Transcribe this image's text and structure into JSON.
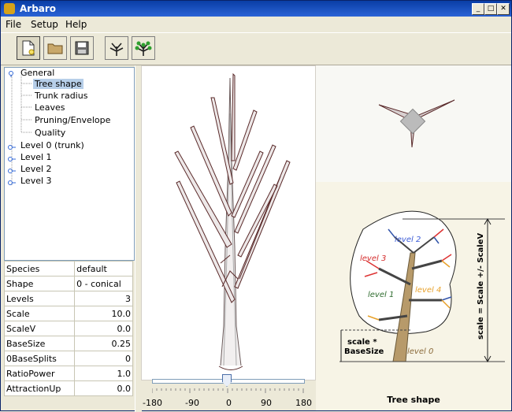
{
  "window": {
    "title": "Arbaro"
  },
  "menu": {
    "items": [
      "File",
      "Setup",
      "Help"
    ]
  },
  "tree": {
    "items": [
      {
        "label": "General"
      },
      {
        "label": "Tree shape"
      },
      {
        "label": "Trunk radius"
      },
      {
        "label": "Leaves"
      },
      {
        "label": "Pruning/Envelope"
      },
      {
        "label": "Quality"
      },
      {
        "label": "Level 0 (trunk)"
      },
      {
        "label": "Level 1"
      },
      {
        "label": "Level 2"
      },
      {
        "label": "Level 3"
      }
    ],
    "selected": "Tree shape"
  },
  "params": {
    "rows": [
      {
        "name": "Species",
        "value": "default"
      },
      {
        "name": "Shape",
        "value": "0 - conical"
      },
      {
        "name": "Levels",
        "value": "3"
      },
      {
        "name": "Scale",
        "value": "10.0"
      },
      {
        "name": "ScaleV",
        "value": "0.0"
      },
      {
        "name": "BaseSize",
        "value": "0.25"
      },
      {
        "name": "0BaseSplits",
        "value": "0"
      },
      {
        "name": "RatioPower",
        "value": "1.0"
      },
      {
        "name": "AttractionUp",
        "value": "0.0"
      }
    ]
  },
  "slider": {
    "ticks": [
      "-180",
      "-90",
      "0",
      "90",
      "180"
    ],
    "value": 0,
    "min": -180,
    "max": 180
  },
  "diagram": {
    "caption": "Tree shape",
    "labels": {
      "level2": "level 2",
      "level3": "level 3",
      "level1": "level 1",
      "level4": "level 4",
      "level0": "level 0",
      "scale_axis": "scale = Scale +/- ScaleV",
      "basesize_line1": "scale *",
      "basesize_line2": "BaseSize"
    }
  },
  "colors": {
    "title_bar": "#0a3ea6",
    "selection": "#b7cfe9",
    "branch": "#5a2a2a"
  }
}
